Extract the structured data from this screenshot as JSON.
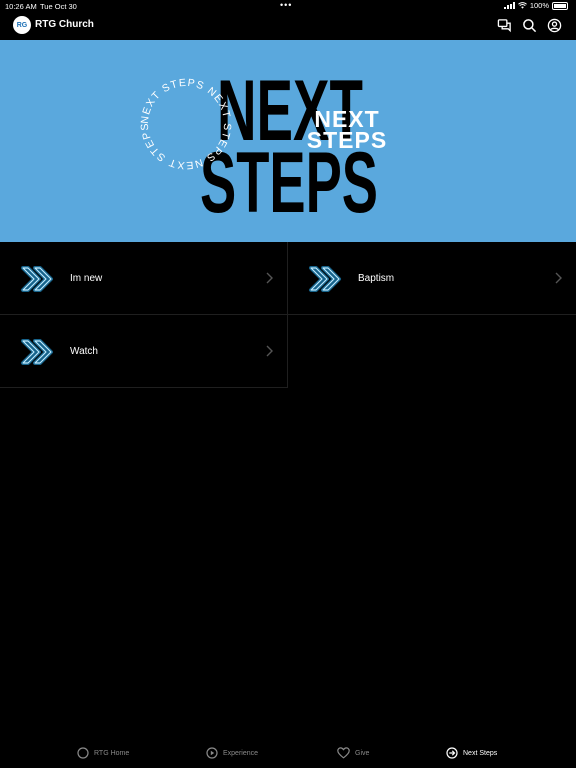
{
  "status_bar": {
    "time": "10:26 AM",
    "date": "Tue Oct 30",
    "battery": "100%"
  },
  "header": {
    "logo_text": "RG",
    "title": "RTG Church",
    "icons": [
      "chat-icon",
      "search-icon",
      "account-icon"
    ]
  },
  "hero": {
    "big_line1": "NEXT",
    "big_line2": "STEPS",
    "overlay_line1": "NEXT",
    "overlay_line2": "STEPS",
    "circle_text": "NEXT STEPS NEXT STEPS NEXT STEPS",
    "background": "#5aa8dd"
  },
  "tiles": [
    {
      "label": "Im new",
      "icon": "double-chevron-icon"
    },
    {
      "label": "Baptism",
      "icon": "double-chevron-icon"
    },
    {
      "label": "Watch",
      "icon": "double-chevron-icon"
    }
  ],
  "tabbar": {
    "tabs": [
      {
        "label": "RTG Home",
        "icon": "circle-icon",
        "active": false
      },
      {
        "label": "Experience",
        "icon": "play-circle-icon",
        "active": false
      },
      {
        "label": "Give",
        "icon": "heart-icon",
        "active": false
      },
      {
        "label": "Next Steps",
        "icon": "arrow-circle-icon",
        "active": true
      }
    ]
  },
  "colors": {
    "accent_glow": "#2ab6ff",
    "tile_border": "#1f1f1f",
    "inactive_tab": "#8a8a8a"
  }
}
